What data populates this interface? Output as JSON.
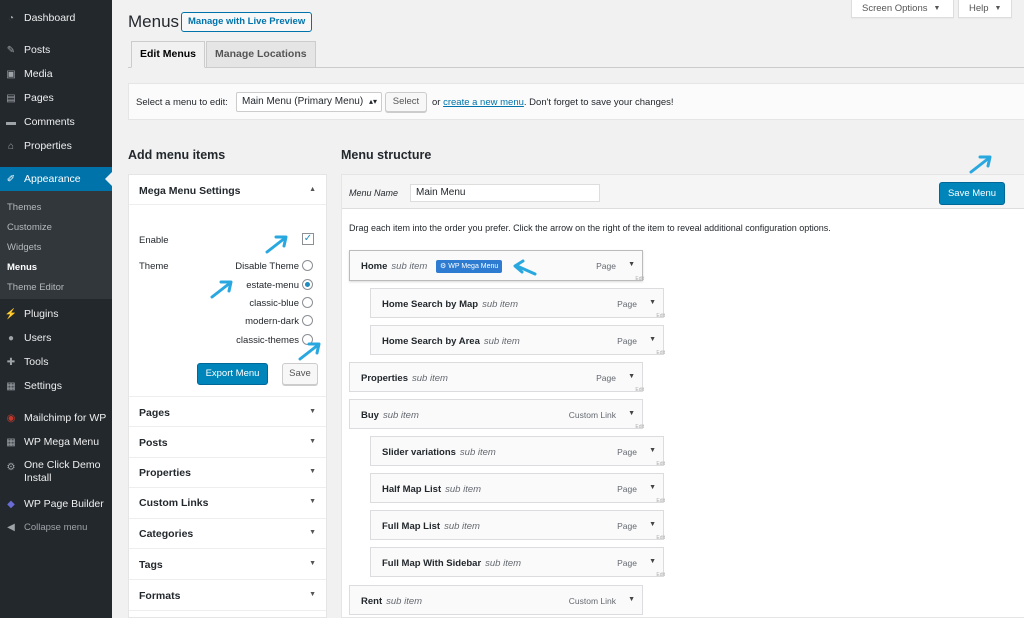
{
  "sidebar": {
    "items": [
      {
        "label": "Dashboard",
        "icon": "dashboard-icon"
      },
      {
        "label": "Posts",
        "icon": "pin-icon"
      },
      {
        "label": "Media",
        "icon": "media-icon"
      },
      {
        "label": "Pages",
        "icon": "pages-icon"
      },
      {
        "label": "Comments",
        "icon": "comment-icon"
      },
      {
        "label": "Properties",
        "icon": "home-icon"
      },
      {
        "label": "Appearance",
        "icon": "brush-icon"
      },
      {
        "label": "Plugins",
        "icon": "plug-icon"
      },
      {
        "label": "Users",
        "icon": "user-icon"
      },
      {
        "label": "Tools",
        "icon": "wrench-icon"
      },
      {
        "label": "Settings",
        "icon": "settings-icon"
      },
      {
        "label": "Mailchimp for WP",
        "icon": "mailchimp-icon"
      },
      {
        "label": "WP Mega Menu",
        "icon": "grid-icon"
      },
      {
        "label": "One Click Demo",
        "label2": "Install",
        "icon": "gear-icon"
      },
      {
        "label": "WP Page Builder",
        "icon": "builder-icon"
      },
      {
        "label": "Collapse menu",
        "icon": "collapse-icon"
      }
    ],
    "submenu": [
      "Themes",
      "Customize",
      "Widgets",
      "Menus",
      "Theme Editor"
    ]
  },
  "header": {
    "title": "Menus",
    "live_preview": "Manage with Live Preview",
    "screen_options": "Screen Options",
    "help": "Help"
  },
  "tabs": [
    "Edit Menus",
    "Manage Locations"
  ],
  "select_bar": {
    "label": "Select a menu to edit:",
    "selected": "Main Menu (Primary Menu)",
    "button": "Select",
    "or": "or",
    "create_link": "create a new menu",
    "after": ". Don't forget to save your changes!"
  },
  "left": {
    "heading": "Add menu items",
    "mega_title": "Mega Menu Settings",
    "enable_label": "Enable",
    "enable_checked": true,
    "theme_label": "Theme",
    "themes": [
      "Disable Theme",
      "estate-menu",
      "classic-blue",
      "modern-dark",
      "classic-themes"
    ],
    "selected_theme": "estate-menu",
    "export_button": "Export Menu",
    "save_button": "Save",
    "sections": [
      "Pages",
      "Posts",
      "Properties",
      "Custom Links",
      "Categories",
      "Tags",
      "Formats"
    ]
  },
  "right": {
    "heading": "Menu structure",
    "menu_name_label": "Menu Name",
    "menu_name_value": "Main Menu",
    "save_menu": "Save Menu",
    "instructions": "Drag each item into the order you prefer. Click the arrow on the right of the item to reveal additional configuration options.",
    "items": [
      {
        "name": "Home",
        "sub": "sub item",
        "type": "Page",
        "depth": 0,
        "badge": "WP Mega Menu"
      },
      {
        "name": "Home Search by Map",
        "sub": "sub item",
        "type": "Page",
        "depth": 1
      },
      {
        "name": "Home Search by Area",
        "sub": "sub item",
        "type": "Page",
        "depth": 1
      },
      {
        "name": "Properties",
        "sub": "sub item",
        "type": "Page",
        "depth": 0
      },
      {
        "name": "Buy",
        "sub": "sub item",
        "type": "Custom Link",
        "depth": 0
      },
      {
        "name": "Slider variations",
        "sub": "sub item",
        "type": "Page",
        "depth": 1
      },
      {
        "name": "Half Map List",
        "sub": "sub item",
        "type": "Page",
        "depth": 1
      },
      {
        "name": "Full Map List",
        "sub": "sub item",
        "type": "Page",
        "depth": 1
      },
      {
        "name": "Full Map With Sidebar",
        "sub": "sub item",
        "type": "Page",
        "depth": 1
      },
      {
        "name": "Rent",
        "sub": "sub item",
        "type": "Custom Link",
        "depth": 0
      }
    ],
    "edit_label": "Edit"
  },
  "colors": {
    "sidebar": "#23282d",
    "accent": "#0073aa",
    "primary_button": "#0085ba",
    "annotation_arrow": "#29a8e0"
  }
}
